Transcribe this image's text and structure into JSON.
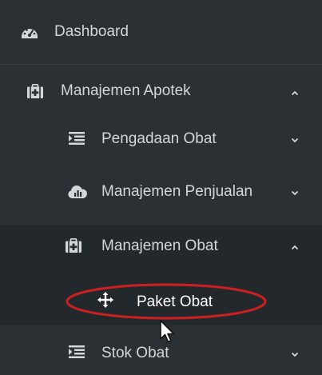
{
  "sidebar": {
    "items": [
      {
        "label": "Dashboard",
        "icon": "dashboard-icon"
      },
      {
        "label": "Manajemen Apotek",
        "icon": "medkit-icon",
        "expanded": true
      },
      {
        "label": "Pengadaan Obat",
        "icon": "list-icon",
        "expanded": false
      },
      {
        "label": "Manajemen Penjualan",
        "icon": "cloud-chart-icon",
        "expanded": false
      },
      {
        "label": "Manajemen Obat",
        "icon": "medkit-icon",
        "expanded": true
      },
      {
        "label": "Paket Obat",
        "icon": "move-arrows-icon"
      },
      {
        "label": "Stok Obat",
        "icon": "list-icon",
        "expanded": false
      }
    ]
  },
  "colors": {
    "sidebar_bg": "#2b3034",
    "active_bg": "#23282c",
    "text": "#d4d7da",
    "highlight_ring": "#cc1f1f"
  }
}
